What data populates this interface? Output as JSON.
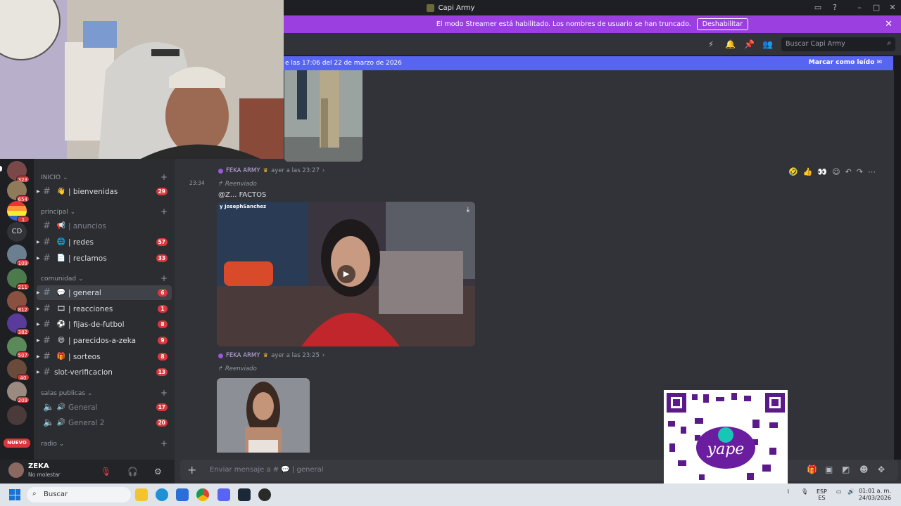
{
  "window": {
    "title": "Capi Army"
  },
  "banner": {
    "text": "El modo Streamer está habilitado. Los nombres de usuario se han truncado.",
    "button": "Deshabilitar"
  },
  "search": {
    "placeholder": "Buscar Capi Army"
  },
  "unread_bar": {
    "text": "e las 17:06 del 22 de marzo de 2026",
    "action": "Marcar como leído"
  },
  "servers": [
    {
      "badge": "323"
    },
    {
      "badge": "654"
    },
    {
      "badge": "1"
    },
    {
      "label": "CD"
    },
    {
      "badge": "109"
    },
    {
      "badge": "211"
    },
    {
      "badge": "812"
    },
    {
      "badge": "382"
    },
    {
      "badge": "507"
    },
    {
      "badge": "40"
    },
    {
      "badge": "209"
    },
    {
      "badge": ""
    }
  ],
  "nuevo_label": "NUEVO",
  "categories": {
    "inicio": "INICIO",
    "principal": "principal",
    "comunidad": "comunidad",
    "salas": "salas publicas",
    "radio": "radio"
  },
  "channels": {
    "bienvenidas": {
      "label": "| bienvenidas",
      "count": "29"
    },
    "anuncios": {
      "label": "| anuncios",
      "count": ""
    },
    "redes": {
      "label": "| redes",
      "count": "57"
    },
    "reclamos": {
      "label": "| reclamos",
      "count": "33"
    },
    "general": {
      "label": "| general",
      "count": "6"
    },
    "reacciones": {
      "label": "| reacciones",
      "count": "1"
    },
    "fijas": {
      "label": "| fijas-de-futbol",
      "count": "8"
    },
    "parecidos": {
      "label": "| parecidos-a-zeka",
      "count": "9"
    },
    "sorteos": {
      "label": "| sorteos",
      "count": "8"
    },
    "slot": {
      "label": "slot-verificacion",
      "count": "13"
    },
    "voice1": {
      "label": "General",
      "count": "17"
    },
    "voice2": {
      "label": "General 2",
      "count": "20"
    }
  },
  "user": {
    "name": "ZEKA",
    "status": "No molestar"
  },
  "messages": {
    "m1_author": "FEKA ARMY",
    "m1_time": "ayer a las 23:27",
    "m2_ts": "23:34",
    "forwarded": "Reenviado",
    "m2_text": "@Z... FACTOS",
    "m2_credit": "y JosephSanchez",
    "m3_author": "FEKA ARMY",
    "m3_time": "ayer a las 23:25",
    "forwarded2": "Reenviado"
  },
  "composer": {
    "placeholder": "Enviar mensaje a # 💬 | general"
  },
  "taskbar": {
    "search": "Buscar",
    "lang1": "ESP",
    "lang2": "ES",
    "time": "01:01 a. m.",
    "date": "24/03/2026"
  },
  "colors": {
    "accent": "#5865f2",
    "banner": "#9b3fe0",
    "badge": "#da373c"
  }
}
